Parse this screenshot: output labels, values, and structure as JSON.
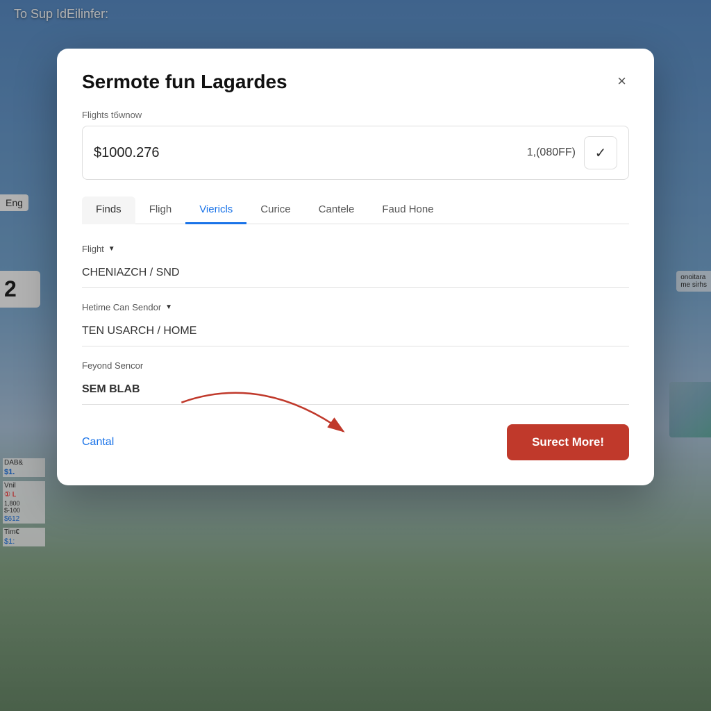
{
  "background": {
    "overlay_text": "To Sup IdEilinfer:"
  },
  "eng_label": "Eng",
  "left_panel": {
    "number": "2"
  },
  "modal": {
    "title": "Sermote fun Lagardes",
    "close_label": "×",
    "price_section": {
      "label": "Flights tбwnow",
      "price": "$1000.276",
      "secondary": "1,(080FF)",
      "check_icon": "✓"
    },
    "tabs": [
      {
        "label": "Finds",
        "active": false
      },
      {
        "label": "Fligh",
        "active": false
      },
      {
        "label": "Viericls",
        "active": true
      },
      {
        "label": "Curice",
        "active": false
      },
      {
        "label": "Cantele",
        "active": false
      },
      {
        "label": "Faud Hone",
        "active": false
      }
    ],
    "fields": [
      {
        "label": "Flight",
        "has_dropdown": true,
        "value": "CHENIAZCH / SND",
        "bold": false
      },
      {
        "label": "Hetime Can Sendor",
        "has_dropdown": true,
        "value": "TEN USARCH / HOME",
        "bold": false
      },
      {
        "label": "Feyond Sencor",
        "has_dropdown": false,
        "value": "SEM BLAB",
        "bold": true
      }
    ],
    "footer": {
      "cancel_label": "Cantal",
      "submit_label": "Surect More!"
    }
  }
}
